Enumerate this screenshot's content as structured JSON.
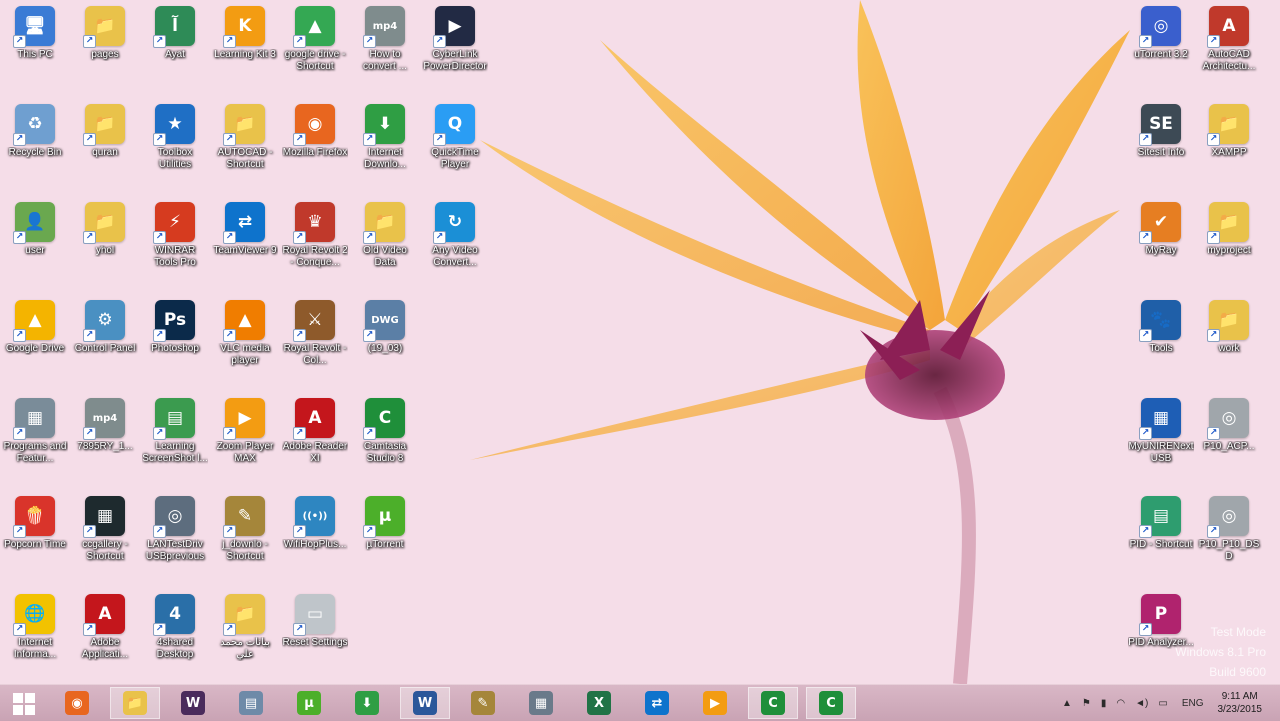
{
  "desktop": {
    "icons": [
      {
        "label": "This PC",
        "glyph": "🖥",
        "color": "#3a7bd5"
      },
      {
        "label": "pages",
        "glyph": "📁",
        "color": "#e9c24a"
      },
      {
        "label": "Ayat",
        "glyph": "آ",
        "color": "#2e8b57"
      },
      {
        "label": "Learning Kit 3",
        "glyph": "K",
        "color": "#f39c12"
      },
      {
        "label": "google drive - Shortcut",
        "glyph": "▲",
        "color": "#34a853"
      },
      {
        "label": "How to convert ...",
        "glyph": "mp4",
        "color": "#7f8c8d"
      },
      {
        "label": "CyberLink PowerDirector",
        "glyph": "▶",
        "color": "#222a44"
      },
      {
        "label": "Recycle Bin",
        "glyph": "♻",
        "color": "#6f9fd0"
      },
      {
        "label": "quran",
        "glyph": "📁",
        "color": "#e9c24a"
      },
      {
        "label": "Toolbox Utilities",
        "glyph": "★",
        "color": "#1f6fc5"
      },
      {
        "label": "AUTOCAD - Shortcut",
        "glyph": "📁",
        "color": "#e9c24a"
      },
      {
        "label": "Mozilla Firefox",
        "glyph": "◉",
        "color": "#e8661f"
      },
      {
        "label": "Internet Downlo...",
        "glyph": "⬇",
        "color": "#2f9e44"
      },
      {
        "label": "QuickTime Player",
        "glyph": "Q",
        "color": "#2a9df4"
      },
      {
        "label": "user",
        "glyph": "👤",
        "color": "#6aa84f"
      },
      {
        "label": "yhol",
        "glyph": "📁",
        "color": "#e9c24a"
      },
      {
        "label": "WINRAR Tools Pro",
        "glyph": "⚡",
        "color": "#d63b1f"
      },
      {
        "label": "TeamViewer 9",
        "glyph": "⇄",
        "color": "#0e73cc"
      },
      {
        "label": "Royal Revolt 2 - Conque...",
        "glyph": "♛",
        "color": "#c0392b"
      },
      {
        "label": "Old Video Data",
        "glyph": "📁",
        "color": "#e9c24a"
      },
      {
        "label": "Any Video Convert...",
        "glyph": "↻",
        "color": "#1b8fd6"
      },
      {
        "label": "Google Drive",
        "glyph": "▲",
        "color": "#f4b400"
      },
      {
        "label": "Control Panel",
        "glyph": "⚙",
        "color": "#4a90c2"
      },
      {
        "label": "Photoshop",
        "glyph": "Ps",
        "color": "#0b2a4a"
      },
      {
        "label": "VLC media player",
        "glyph": "▲",
        "color": "#f07d00"
      },
      {
        "label": "Royal Revolt - Col...",
        "glyph": "⚔",
        "color": "#8e5a2b"
      },
      {
        "label": "(19_03)",
        "glyph": "DWG",
        "color": "#5b7fa6"
      },
      {
        "label": "Programs and Featur...",
        "glyph": "▦",
        "color": "#7a8c99"
      },
      {
        "label": "7895RY_1...",
        "glyph": "mp4",
        "color": "#7f8c8d"
      },
      {
        "label": "Learning ScreenShot l...",
        "glyph": "▤",
        "color": "#3b9b4f"
      },
      {
        "label": "Zoom Player MAX",
        "glyph": "▶",
        "color": "#f39c12"
      },
      {
        "label": "Adobe Reader XI",
        "glyph": "A",
        "color": "#c4161c"
      },
      {
        "label": "Camtasia Studio 8",
        "glyph": "C",
        "color": "#1f8f3a"
      },
      {
        "label": "Popcorn Time",
        "glyph": "🍿",
        "color": "#d9342b"
      },
      {
        "label": "ccgallery - Shortcut",
        "glyph": "▦",
        "color": "#1e2a2e"
      },
      {
        "label": "LANTestDriv USBprevious",
        "glyph": "◎",
        "color": "#5d6d7e"
      },
      {
        "label": "j_downlo - Shortcut",
        "glyph": "✎",
        "color": "#a5863a"
      },
      {
        "label": "WifiHopPlus...",
        "glyph": "((•))",
        "color": "#2e86c1"
      },
      {
        "label": "µTorrent",
        "glyph": "µ",
        "color": "#4caf2a"
      },
      {
        "label": "Internet Informa...",
        "glyph": "🌐",
        "color": "#f2c200"
      },
      {
        "label": "Adobe Applicati...",
        "glyph": "A",
        "color": "#c4161c"
      },
      {
        "label": "4shared Desktop",
        "glyph": "4",
        "color": "#2a6fa8"
      },
      {
        "label": "بيانات محمد علي",
        "glyph": "📁",
        "color": "#e9c24a"
      },
      {
        "label": "Reset Settings",
        "glyph": "▭",
        "color": "#bfc5ca"
      },
      {
        "label": "uTorrent 3.2",
        "glyph": "◎",
        "color": "#3a5fcd"
      },
      {
        "label": "AutoCAD Architectu...",
        "glyph": "A",
        "color": "#c0392b"
      },
      {
        "label": "Sitesit Info",
        "glyph": "SE",
        "color": "#3d4a55"
      },
      {
        "label": "XAMPP",
        "glyph": "📁",
        "color": "#e9c24a"
      },
      {
        "label": "MyRay",
        "glyph": "✔",
        "color": "#e67e22"
      },
      {
        "label": "myproject",
        "glyph": "📁",
        "color": "#e9c24a"
      },
      {
        "label": "Tools",
        "glyph": "🐾",
        "color": "#1f5fa8"
      },
      {
        "label": "work",
        "glyph": "📁",
        "color": "#e9c24a"
      },
      {
        "label": "MyUNIRENext USB",
        "glyph": "▦",
        "color": "#1e5eb5"
      },
      {
        "label": "P10_ACP...",
        "glyph": "◎",
        "color": "#a0a6ab"
      },
      {
        "label": "PID - Shortcut",
        "glyph": "▤",
        "color": "#2e9d6f"
      },
      {
        "label": "P10_P10_DSD",
        "glyph": "◎",
        "color": "#a0a6ab"
      },
      {
        "label": "PID Analyzer...",
        "glyph": "P",
        "color": "#b0236e"
      }
    ]
  },
  "taskbar": {
    "start_label": "Start",
    "apps": [
      {
        "name": "firefox",
        "glyph": "◉",
        "color": "#e8661f",
        "active": false
      },
      {
        "name": "file-explorer",
        "glyph": "📁",
        "color": "#e9c24a",
        "active": true
      },
      {
        "name": "winrar",
        "glyph": "W",
        "color": "#4a2b5c",
        "active": false
      },
      {
        "name": "notepad",
        "glyph": "▤",
        "color": "#6e8aa8",
        "active": false
      },
      {
        "name": "utorrent",
        "glyph": "µ",
        "color": "#4caf2a",
        "active": false
      },
      {
        "name": "internet-download-manager",
        "glyph": "⬇",
        "color": "#2f9e44",
        "active": false
      },
      {
        "name": "word",
        "glyph": "W",
        "color": "#2b579a",
        "active": true
      },
      {
        "name": "jdownloader",
        "glyph": "✎",
        "color": "#a5863a",
        "active": false
      },
      {
        "name": "calculator",
        "glyph": "▦",
        "color": "#6a7a8a",
        "active": false
      },
      {
        "name": "excel",
        "glyph": "X",
        "color": "#217346",
        "active": false
      },
      {
        "name": "teamviewer",
        "glyph": "⇄",
        "color": "#0e73cc",
        "active": false
      },
      {
        "name": "zoom-player",
        "glyph": "▶",
        "color": "#f39c12",
        "active": false
      },
      {
        "name": "camtasia-recorder",
        "glyph": "C",
        "color": "#1f8f3a",
        "active": true
      },
      {
        "name": "camtasia-studio",
        "glyph": "C",
        "color": "#1f8f3a",
        "active": true
      }
    ],
    "tray": {
      "language": "ENG",
      "time": "9:11 AM",
      "date": "3/23/2015"
    }
  },
  "watermark": {
    "line1": "Test Mode",
    "line2": "Windows 8.1 Pro",
    "line3": "Build 9600"
  }
}
